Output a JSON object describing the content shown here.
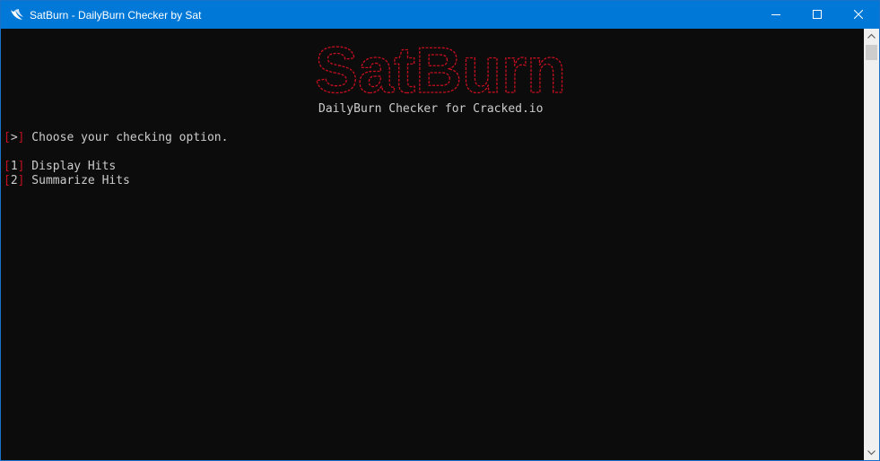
{
  "window": {
    "title": "SatBurn - DailyBurn Checker by Sat",
    "icon": "wing-icon",
    "controls": [
      "minimize-icon",
      "maximize-icon",
      "close-icon"
    ]
  },
  "console": {
    "banner_text": "SatBurn",
    "banner_color": "#c50f1f",
    "subtitle": "DailyBurn Checker for Cracked.io",
    "prompt_bracket_open": "[",
    "prompt_marker": ">",
    "prompt_bracket_close": "]",
    "prompt_text": " Choose your checking option.",
    "options": [
      {
        "bracket_open": "[",
        "key": "1",
        "bracket_close": "]",
        "label": " Display Hits"
      },
      {
        "bracket_open": "[",
        "key": "2",
        "bracket_close": "]",
        "label": " Summarize Hits"
      }
    ]
  },
  "colors": {
    "titlebar": "#0078d7",
    "console_bg": "#0c0c0c",
    "console_text": "#cccccc",
    "accent_red": "#c50f1f"
  }
}
